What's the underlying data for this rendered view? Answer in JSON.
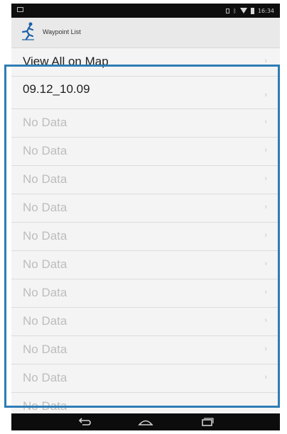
{
  "action_bar": {
    "title": "Waypoint List",
    "icon": "running-figure-icon"
  },
  "list": {
    "header_item": "View All on Map",
    "items": [
      "09.12_10.09",
      "No Data",
      "No Data",
      "No Data",
      "No Data",
      "No Data",
      "No Data",
      "No Data",
      "No Data",
      "No Data",
      "No Data",
      "No Data"
    ]
  },
  "navigation": {
    "back": "back-icon",
    "home": "home-icon",
    "recents": "recent-apps-icon"
  },
  "colors": {
    "highlight_border": "#2e7db5",
    "status_bar": "#0e0e0e",
    "nav_bar": "#0c0c0c"
  }
}
